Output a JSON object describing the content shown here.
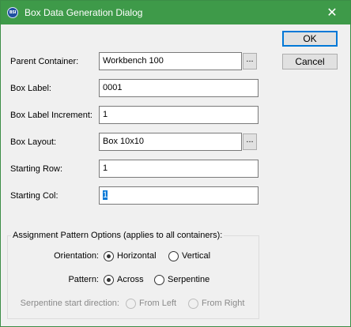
{
  "window": {
    "title": "Box Data Generation Dialog",
    "app_icon_text": "BSI",
    "close_glyph": "✕",
    "accent": "#3e9a49"
  },
  "buttons": {
    "ok": "OK",
    "cancel": "Cancel",
    "browse": "..."
  },
  "fields": {
    "parent_container": {
      "label": "Parent Container:",
      "value": "Workbench 100"
    },
    "box_label": {
      "label": "Box Label:",
      "value": "0001"
    },
    "box_label_increment": {
      "label": "Box Label Increment:",
      "value": "1"
    },
    "box_layout": {
      "label": "Box Layout:",
      "value": "Box 10x10"
    },
    "starting_row": {
      "label": "Starting Row:",
      "value": "1"
    },
    "starting_col": {
      "label": "Starting Col:",
      "value": "1"
    }
  },
  "assignment": {
    "title": "Assignment Pattern Options (applies to all containers):",
    "orientation": {
      "label": "Orientation:",
      "options": [
        "Horizontal",
        "Vertical"
      ],
      "selected": "Horizontal"
    },
    "pattern": {
      "label": "Pattern:",
      "options": [
        "Across",
        "Serpentine"
      ],
      "selected": "Across"
    },
    "serpentine_start": {
      "label": "Serpentine start direction:",
      "options": [
        "From Left",
        "From Right"
      ],
      "selected": null,
      "enabled": false
    }
  }
}
